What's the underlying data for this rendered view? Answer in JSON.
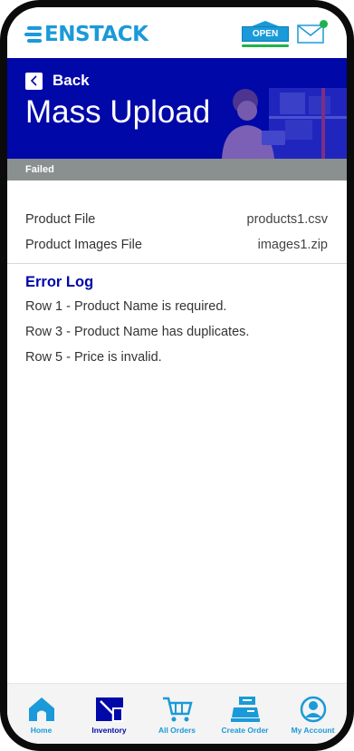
{
  "brand": {
    "logo_text": "ENSTACK",
    "open_label": "OPEN"
  },
  "colors": {
    "primary_blue": "#0008a8",
    "accent_blue": "#1a9ad9",
    "status_gray": "#8a8f8f",
    "online_green": "#1fb14c"
  },
  "header": {
    "back_label": "Back",
    "title": "Mass Upload",
    "status": "Failed"
  },
  "files": [
    {
      "label": "Product File",
      "value": "products1.csv"
    },
    {
      "label": "Product Images File",
      "value": "images1.zip"
    }
  ],
  "error_log": {
    "title": "Error Log",
    "items": [
      "Row 1 - Product Name is required.",
      "Row 3 - Product Name has duplicates.",
      "Row 5 - Price is invalid."
    ]
  },
  "nav": [
    {
      "label": "Home",
      "icon": "home-icon"
    },
    {
      "label": "Inventory",
      "icon": "inventory-icon",
      "active": true
    },
    {
      "label": "All Orders",
      "icon": "cart-icon"
    },
    {
      "label": "Create Order",
      "icon": "register-icon"
    },
    {
      "label": "My Account",
      "icon": "account-icon"
    }
  ]
}
